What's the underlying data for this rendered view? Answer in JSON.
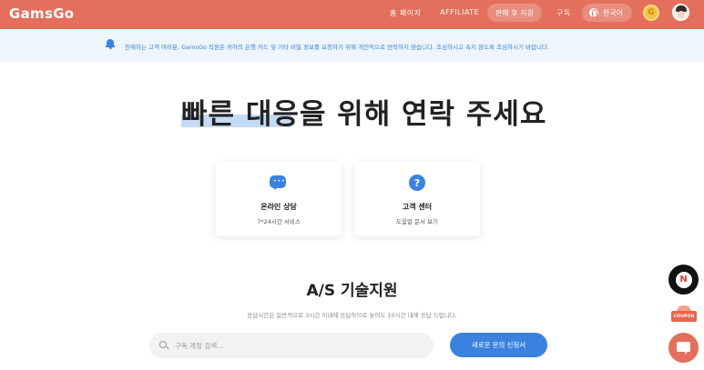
{
  "header": {
    "logo": "GamsGo",
    "nav": {
      "home": "홈 페이지",
      "affiliate": "AFFILIATE",
      "after_sales": "판매 후 지원",
      "subscribe": "구독"
    },
    "language": "한국어",
    "coin_letter": "G",
    "background_color": "#e36f5c"
  },
  "notice": {
    "text": "친애하는 고객 여러분, GamsGo 직원은 귀하의 은행 카드 및 기타 비밀 정보를 요청하기 위해 개인적으로 연락하지 않습니다. 조심하시고 속지 않도록 조심하시기 바랍니다.",
    "icon": "bell-icon"
  },
  "headline": "빠른 대응을 위해 연락 주세요",
  "cards": [
    {
      "icon": "chat-icon",
      "title": "온라인 상담",
      "subtitle": "7*24시간 서비스"
    },
    {
      "icon": "help-icon",
      "title": "고객 센터",
      "subtitle": "도움말 문서 보기"
    }
  ],
  "as_section": {
    "title": "A/S 기술지원",
    "description": "응답시간은 일반적으로 3시간 이내에 응답하므로 늦어도 10시간 내에 응답 드립니다.",
    "search_placeholder": "구독 계정 검색...",
    "apply_button": "새로운 문의 신청서"
  },
  "floating": {
    "n_badge": "N",
    "coupon": "COUPON"
  },
  "colors": {
    "brand": "#e36f5c",
    "accent": "#3b82e0",
    "notice_bg": "#eef5fc"
  }
}
